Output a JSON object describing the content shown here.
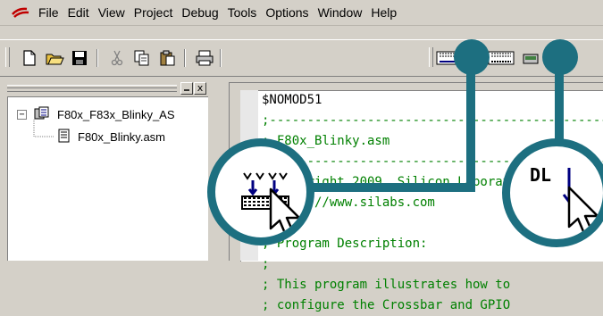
{
  "menubar": {
    "items": [
      {
        "label": "File",
        "name": "menu-file"
      },
      {
        "label": "Edit",
        "name": "menu-edit"
      },
      {
        "label": "View",
        "name": "menu-view"
      },
      {
        "label": "Project",
        "name": "menu-project"
      },
      {
        "label": "Debug",
        "name": "menu-debug"
      },
      {
        "label": "Tools",
        "name": "menu-tools"
      },
      {
        "label": "Options",
        "name": "menu-options"
      },
      {
        "label": "Window",
        "name": "menu-window"
      },
      {
        "label": "Help",
        "name": "menu-help"
      }
    ]
  },
  "toolbar": {
    "left_icons": [
      "new-file-icon",
      "open-folder-icon",
      "save-icon",
      "cut-icon",
      "copy-icon",
      "paste-icon",
      "print-icon"
    ],
    "right_icons": [
      "download-build-icon",
      "download-debug-icon",
      "connect-icon"
    ]
  },
  "project_panel": {
    "close_label": "x",
    "tree": {
      "project": {
        "label": "F80x_F83x_Blinky_AS",
        "expander": "−"
      },
      "file": {
        "label": "F80x_Blinky.asm"
      }
    }
  },
  "editor": {
    "lines": [
      {
        "text": "$NOMOD51",
        "kind": "code"
      },
      {
        "text": ";-----------------------------------------------",
        "kind": "comment"
      },
      {
        "text": "; F80x_Blinky.asm",
        "kind": "comment"
      },
      {
        "text": ";-----------------------------------------------",
        "kind": "comment"
      },
      {
        "text": "; Copyright 2009, Silicon Laboratories",
        "kind": "comment"
      },
      {
        "text": "; http://www.silabs.com",
        "kind": "comment"
      },
      {
        "text": ";",
        "kind": "comment"
      },
      {
        "text": "; Program Description:",
        "kind": "comment"
      },
      {
        "text": ";",
        "kind": "comment"
      },
      {
        "text": "; This program illustrates how to",
        "kind": "comment"
      },
      {
        "text": "; configure the Crossbar and GPIO",
        "kind": "comment"
      }
    ]
  },
  "callouts": {
    "left_icon_caption": "",
    "right_icon_text": "DL"
  },
  "colors": {
    "callout": "#1d6f80",
    "comment": "#008000",
    "chrome": "#d4d0c8"
  }
}
